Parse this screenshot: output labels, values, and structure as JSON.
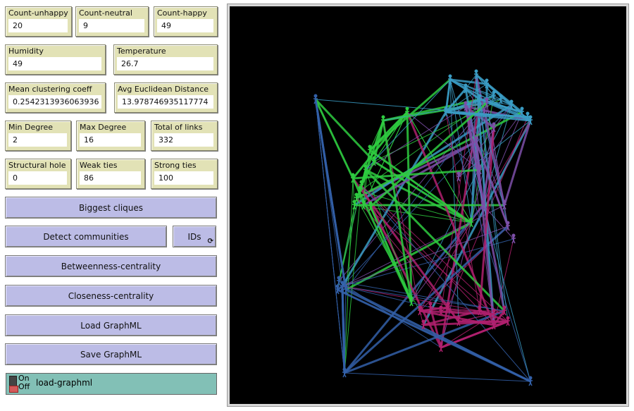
{
  "monitors": [
    {
      "label": "Count-unhappy",
      "value": "20"
    },
    {
      "label": "Count-neutral",
      "value": "9"
    },
    {
      "label": "Count-happy",
      "value": "49"
    },
    {
      "label": "Humidity",
      "value": "49"
    },
    {
      "label": "Temperature",
      "value": "26.7"
    },
    {
      "label": "Mean clustering coeff",
      "value": "0.2542313936063936"
    },
    {
      "label": "Avg Euclidean Distance",
      "value": "13.978746935117774"
    },
    {
      "label": "Min Degree",
      "value": "2"
    },
    {
      "label": "Max Degree",
      "value": "16"
    },
    {
      "label": "Total of links",
      "value": "332"
    },
    {
      "label": "Structural hole",
      "value": "0"
    },
    {
      "label": "Weak ties",
      "value": "86"
    },
    {
      "label": "Strong ties",
      "value": "100"
    }
  ],
  "buttons": {
    "biggest_cliques": "Biggest cliques",
    "detect_communities": "Detect communities",
    "ids": "IDs",
    "betweenness": "Betweenness-centrality",
    "closeness": "Closeness-centrality",
    "load": "Load GraphML",
    "save": "Save GraphML"
  },
  "switch": {
    "label": "load-graphml",
    "on": "On",
    "off": "Off",
    "state": "off"
  },
  "view": {
    "background": "#000000",
    "community_colors": {
      "teal": "#3a9cc4",
      "green": "#2ecc40",
      "purple": "#7d4fa8",
      "blue": "#3360a8",
      "magenta": "#b0206e"
    }
  }
}
